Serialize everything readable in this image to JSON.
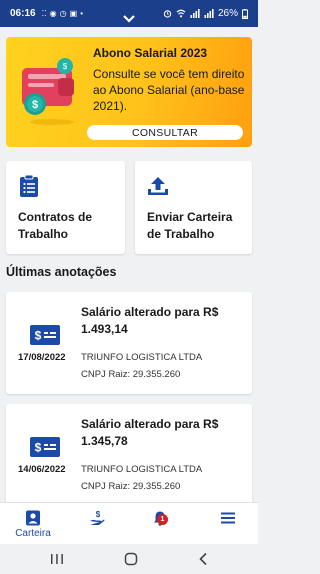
{
  "status": {
    "time": "06:16",
    "battery": "26%"
  },
  "promo": {
    "title": "Abono Salarial 2023",
    "description": "Consulte se você tem direito ao Abono Salarial (ano-base 2021).",
    "button": "CONSULTAR"
  },
  "quick_actions": [
    {
      "label_line1": "Contratos de",
      "label_line2": "Trabalho",
      "icon": "clipboard-list-icon"
    },
    {
      "label_line1": "Enviar Carteira",
      "label_line2": "de Trabalho",
      "icon": "upload-icon"
    }
  ],
  "section_title": "Últimas anotações",
  "notes": [
    {
      "title_line1": "Salário alterado para R$",
      "title_line2": "1.493,14",
      "date": "17/08/2022",
      "company": "TRIUNFO LOGISTICA LTDA",
      "cnpj": "CNPJ Raiz: 29.355.260"
    },
    {
      "title_line1": "Salário alterado para R$",
      "title_line2": "1.345,78",
      "date": "14/06/2022",
      "company": "TRIUNFO LOGISTICA LTDA",
      "cnpj": "CNPJ Raiz: 29.355.260"
    }
  ],
  "bottom_nav": {
    "carteira_label": "Carteira",
    "notifications_badge": "1"
  },
  "colors": {
    "primary": "#1b3f8b",
    "accent": "#1b4aa8",
    "promo": "#ffc21a"
  }
}
